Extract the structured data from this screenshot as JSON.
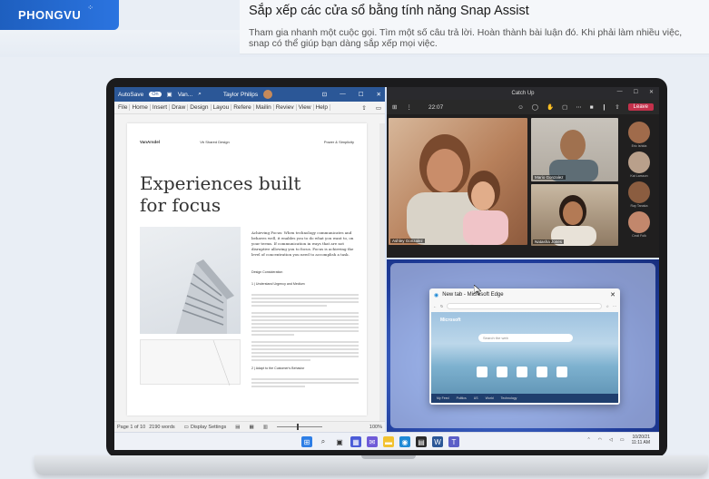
{
  "header": {
    "brand": "PHONGVU",
    "title": "Sắp xếp các cửa sổ bằng tính năng Snap Assist",
    "description": "Tham gia nhanh một cuộc gọi. Tìm một số câu trả lời. Hoàn thành bài luận đó. Khi phải làm nhiều việc, snap có thể giúp bạn dàng sắp xếp mọi việc."
  },
  "word": {
    "autosave": "AutoSave",
    "autosave_state": "On",
    "filename": "Van...",
    "user": "Taylor Philips",
    "menu": [
      "File",
      "Home",
      "Insert",
      "Draw",
      "Design",
      "Layout",
      "References",
      "Mailings",
      "Review",
      "View",
      "Help"
    ],
    "menu_shown": [
      "File",
      "Home",
      "Insert",
      "Draw",
      "Design",
      "Layou",
      "Refere",
      "Mailin",
      "Reviev",
      "View",
      "Help"
    ],
    "doc": {
      "brand": "VanArsdel",
      "header_mid": "Vb Shared Design",
      "header_right": "Power & Simplicity",
      "heading": "Experiences built for focus",
      "lead": "Achieving Focus: When technology communicates and behaves well, it enables you to do what you want to, on your terms. If communication in ways that are not disruptive allowing you to focus. Focus is achieving the level of concentration you need to accomplish a task.",
      "section": "Design Consideration",
      "sub1": "1 | Understand Urgency and Medium",
      "sub2": "2 | Adapt to the Customer's Behavior"
    },
    "status": {
      "pages": "Page 1 of 10",
      "words": "2190 words",
      "display": "Display Settings",
      "zoom": "100%"
    }
  },
  "teams": {
    "title": "Catch Up",
    "time": "22:07",
    "leave": "Leave",
    "participants": [
      {
        "name": "Ashley Gonzalez"
      },
      {
        "name": "Mario Gonzalez"
      },
      {
        "name": "Natasha Jones"
      }
    ],
    "side": [
      "Eric Ishida",
      "Kat Larsson",
      "Ray Tanaka",
      "Cecil Folk"
    ]
  },
  "edge": {
    "tab": "New tab - Microsoft Edge",
    "brand": "Microsoft",
    "search_placeholder": "Search the web",
    "footer": [
      "My Feed",
      "Politics",
      "US",
      "World",
      "Technology"
    ]
  },
  "taskbar": {
    "date": "10/20/21",
    "time": "11:11 AM"
  },
  "colors": {
    "word_blue": "#2b5797",
    "teams_dark": "#201f1f",
    "leave_red": "#c4314b",
    "brand_blue": "#1e5fbf"
  }
}
